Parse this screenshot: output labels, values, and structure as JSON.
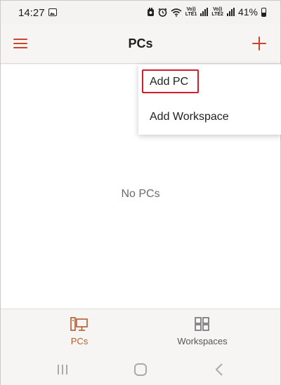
{
  "status_bar": {
    "time": "14:27",
    "battery": "41%",
    "sim1_top": "Vo))",
    "sim1_bottom": "LTE1",
    "sim2_top": "Vo))",
    "sim2_bottom": "LTE2",
    "icons": [
      "gallery-icon",
      "alarm-icon",
      "wifi-icon",
      "signal-icon",
      "battery-icon"
    ]
  },
  "app_bar": {
    "title": "PCs",
    "menu_icon": "hamburger-menu-icon",
    "add_icon": "plus-icon"
  },
  "dropdown": {
    "items": [
      {
        "label": "Add PC",
        "highlighted": true
      },
      {
        "label": "Add Workspace",
        "highlighted": false
      }
    ]
  },
  "main": {
    "empty_text": "No PCs"
  },
  "bottom_nav": {
    "tabs": [
      {
        "label": "PCs",
        "icon": "pc-icon",
        "active": true
      },
      {
        "label": "Workspaces",
        "icon": "workspaces-icon",
        "active": false
      }
    ]
  },
  "colors": {
    "accent": "#c9462c",
    "active_tab": "#b05d2c",
    "highlight_border": "#d01c2c"
  }
}
